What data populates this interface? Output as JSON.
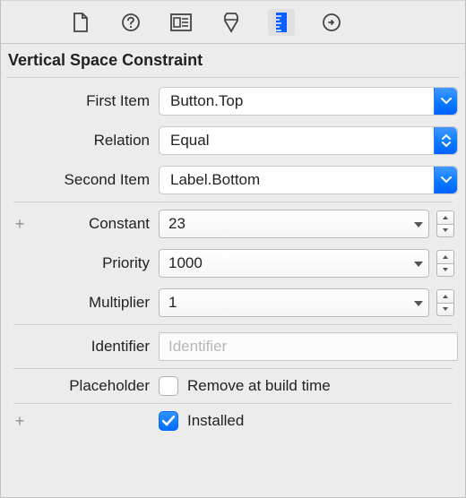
{
  "header": {
    "title": "Vertical Space Constraint"
  },
  "toolbar": {
    "icons": [
      "file-icon",
      "help-icon",
      "identity-icon",
      "attributes-icon",
      "size-icon",
      "connections-icon"
    ],
    "active_index": 4
  },
  "labels": {
    "first_item": "First Item",
    "relation": "Relation",
    "second_item": "Second Item",
    "constant": "Constant",
    "priority": "Priority",
    "multiplier": "Multiplier",
    "identifier": "Identifier",
    "placeholder": "Placeholder",
    "placeholder_option": "Remove at build time",
    "installed": "Installed"
  },
  "values": {
    "first_item": "Button.Top",
    "relation": "Equal",
    "second_item": "Label.Bottom",
    "constant": "23",
    "priority": "1000",
    "multiplier": "1",
    "identifier": "",
    "identifier_placeholder": "Identifier",
    "remove_at_build_time": false,
    "installed": true
  },
  "colors": {
    "accent": "#0a7bff",
    "panel_bg": "#ececec"
  }
}
